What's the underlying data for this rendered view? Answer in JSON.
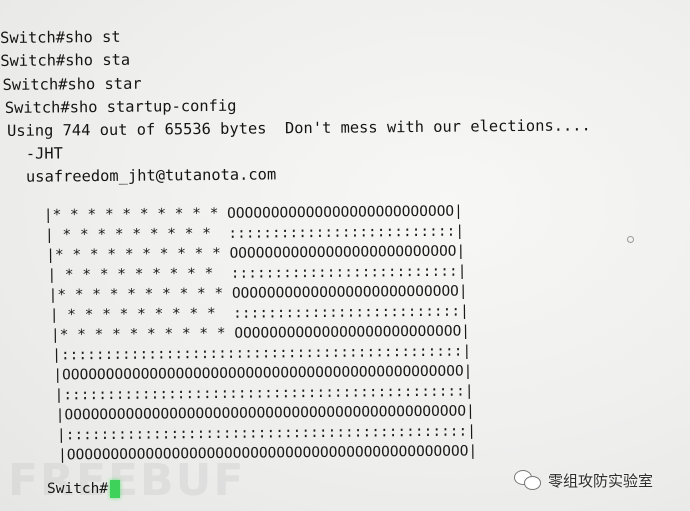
{
  "terminal": {
    "lines": [
      "Switch#sho st",
      "Switch#sho sta",
      "Switch#sho star",
      "Switch#sho startup-config",
      "Using 744 out of 65536 bytes  Don't mess with our elections....",
      "  -JHT",
      "  usafreedom_jht@tutanota.com"
    ],
    "flag_rows": [
      "|* * * * * * * * * * OOOOOOOOOOOOOOOOOOOOOOOOOO|",
      "| * * * * * * * * *  ::::::::::::::::::::::::::|",
      "|* * * * * * * * * * OOOOOOOOOOOOOOOOOOOOOOOOOO|",
      "| * * * * * * * * *  ::::::::::::::::::::::::::|",
      "|* * * * * * * * * * OOOOOOOOOOOOOOOOOOOOOOOOOO|",
      "| * * * * * * * * *  ::::::::::::::::::::::::::|",
      "|* * * * * * * * * * OOOOOOOOOOOOOOOOOOOOOOOOOO|",
      "|::::::::::::::::::::::::::::::::::::::::::::::|",
      "|OOOOOOOOOOOOOOOOOOOOOOOOOOOOOOOOOOOOOOOOOOOOOO|",
      "|::::::::::::::::::::::::::::::::::::::::::::::|",
      "|OOOOOOOOOOOOOOOOOOOOOOOOOOOOOOOOOOOOOOOOOOOOOO|",
      "|::::::::::::::::::::::::::::::::::::::::::::::|",
      "|OOOOOOOOOOOOOOOOOOOOOOOOOOOOOOOOOOOOOOOOOOOOOO|"
    ],
    "prompt": "Switch#",
    "cursor_color": "#3fd25a"
  },
  "watermark": {
    "left_text": "FREEBUF",
    "right_text": "零组攻防实验室",
    "right_icon": "wechat-icon"
  }
}
